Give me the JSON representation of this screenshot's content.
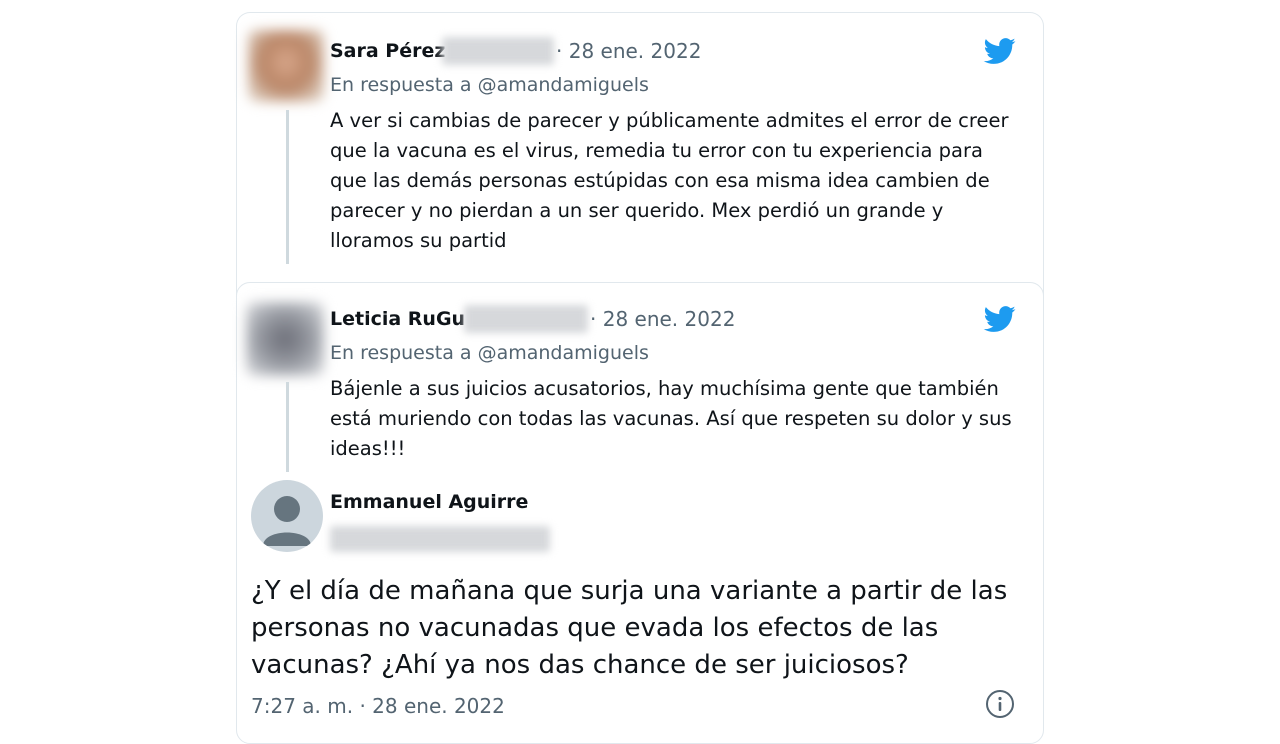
{
  "tweets": [
    {
      "name": "Sara Pérez",
      "date": "· 28 ene. 2022",
      "reply": "En respuesta a @amandamiguels",
      "text": "A ver si cambias de parecer y públicamente admites el error de creer que la vacuna es el virus, remedia tu error con tu experiencia para que las demás personas estúpidas con esa misma idea cambien de parecer y no pierdan a un ser querido. Mex perdió un grande y lloramos su partid"
    },
    {
      "name": "Leticia RuGu",
      "date": "· 28 ene. 2022",
      "reply": "En respuesta a @amandamiguels",
      "text": "Bájenle a sus juicios acusatorios, hay muchísima gente que también está muriendo con todas las vacunas. Así que respeten su dolor y sus ideas!!!"
    }
  ],
  "main": {
    "name": "Emmanuel Aguirre",
    "text": "¿Y el día de mañana que surja una variante a partir de las personas no vacunadas que evada los efectos de las vacunas? ¿Ahí ya nos das chance de ser juiciosos?",
    "time": "7:27 a. m. · 28 ene. 2022"
  },
  "icons": {
    "brand": "twitter-bird-icon",
    "info": "info-icon"
  },
  "colors": {
    "brand": "#1d9bf0",
    "secondary_text": "#536471",
    "thread_line": "#cfd9de"
  }
}
